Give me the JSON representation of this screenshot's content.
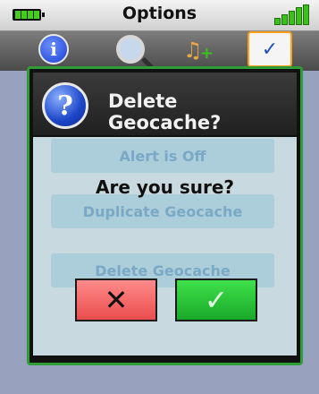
{
  "status_bar": {
    "title": "Options",
    "battery_icon": "battery-icon",
    "signal_icon": "signal-strength-icon"
  },
  "toolbar": {
    "items": [
      {
        "icon": "info-icon"
      },
      {
        "icon": "search-icon"
      },
      {
        "icon": "media-add-icon"
      },
      {
        "icon": "checklist-icon"
      }
    ]
  },
  "background_list": {
    "items": [
      "Alert is Off",
      "Duplicate Geocache",
      "Delete Geocache"
    ]
  },
  "dialog": {
    "title": "Delete Geocache?",
    "icon": "help-icon",
    "message": "Are you sure?",
    "cancel_glyph": "✕",
    "confirm_glyph": "✓"
  },
  "colors": {
    "accent_green": "#2f9d36",
    "cancel_red": "#ea4d4d",
    "confirm_green": "#19a92a"
  }
}
